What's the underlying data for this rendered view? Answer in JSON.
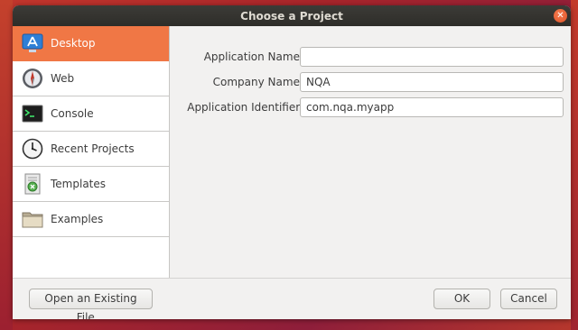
{
  "window": {
    "title": "Choose a Project"
  },
  "sidebar": {
    "items": [
      {
        "label": "Desktop",
        "icon": "desktop-app-icon",
        "active": true
      },
      {
        "label": "Web",
        "icon": "web-safari-icon"
      },
      {
        "label": "Console",
        "icon": "console-terminal-icon"
      },
      {
        "label": "Recent Projects",
        "icon": "clock-icon"
      },
      {
        "label": "Templates",
        "icon": "templates-icon"
      },
      {
        "label": "Examples",
        "icon": "folder-icon"
      }
    ]
  },
  "form": {
    "application_name": {
      "label": "Application Name:",
      "value": ""
    },
    "company_name": {
      "label": "Company Name:",
      "value": "NQA"
    },
    "application_identifier": {
      "label": "Application Identifier:",
      "value": "com.nqa.myapp"
    }
  },
  "buttons": {
    "open_existing": "Open an Existing File...",
    "ok": "OK",
    "cancel": "Cancel"
  },
  "colors": {
    "accent": "#f07745",
    "titlebar": "#2e2d29",
    "close": "#e0552a"
  }
}
